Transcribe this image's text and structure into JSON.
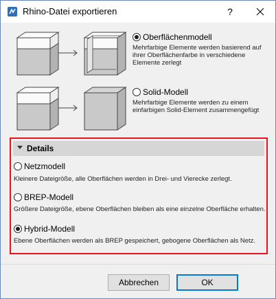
{
  "window": {
    "title": "Rhino-Datei exportieren",
    "help_label": "?",
    "accent_color": "#e8131b"
  },
  "options": {
    "surface": {
      "label": "Oberflächenmodell",
      "description": "Mehrfarbige Elemente werden basierend auf ihrer Oberflächenfarbe in verschiedene Elemente zerlegt",
      "selected": true
    },
    "solid": {
      "label": "Solid-Modell",
      "description": "Mehrfarbige Elemente werden zu einem einfarbigen Solid-Element zusammengefügt",
      "selected": false
    }
  },
  "details": {
    "title": "Details",
    "mesh": {
      "label": "Netzmodell",
      "description": "Kleinere Dateigröße, alle Oberflächen werden in Drei- und Vierecke zerlegt.",
      "selected": false
    },
    "brep": {
      "label": "BREP-Modell",
      "description": "Größere Dateigröße, ebene Oberflächen bleiben als eine einzelne Oberfläche erhalten.",
      "selected": false
    },
    "hybrid": {
      "label": "Hybrid-Modell",
      "description": "Ebene Oberflächen werden als BREP gespeichert, gebogene Oberflächen als Netz.",
      "selected": true
    }
  },
  "buttons": {
    "cancel": "Abbrechen",
    "ok": "OK"
  }
}
